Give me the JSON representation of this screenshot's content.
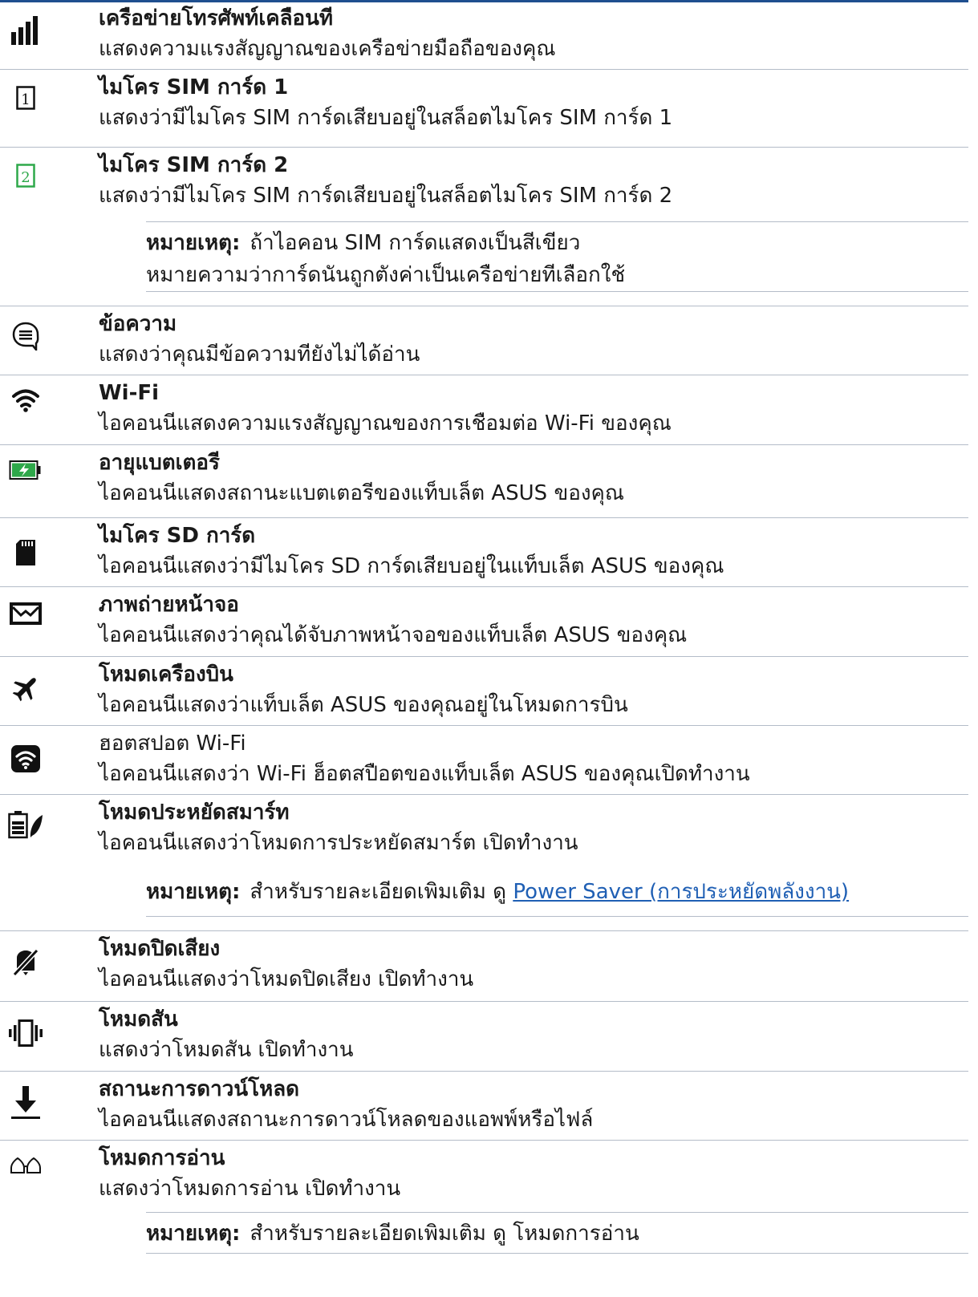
{
  "entries": [
    {
      "icon": "signal-bars-icon",
      "title": "เครือข่ายโทรศัพท์เคลือนที",
      "desc": "แสดงความแรงสัญญาณของเครือข่ายมือถือของคุณ"
    },
    {
      "icon": "sim-card-1-icon",
      "title": "ไมโคร SIM การ์ด 1",
      "desc": "แสดงว่ามีไมโคร SIM การ์ดเสียบอยู่ในสล็อตไมโคร SIM การ์ด 1"
    },
    {
      "icon": "sim-card-2-icon",
      "title": "ไมโคร SIM การ์ด 2",
      "desc": "แสดงว่ามีไมโคร SIM การ์ดเสียบอยู่ในสล็อตไมโคร SIM การ์ด 2"
    },
    {
      "icon": "message-icon",
      "title": "ข้อความ",
      "desc": "แสดงว่าคุณมีข้อความทียังไม่ได้อ่าน"
    },
    {
      "icon": "wifi-icon",
      "title": " Wi-Fi",
      "desc": "ไอคอนนีแสดงความแรงสัญญาณของการเชือมต่อ Wi-Fi ของคุณ"
    },
    {
      "icon": "battery-charging-icon",
      "title": "อายุแบตเตอรี",
      "desc": "ไอคอนนีแสดงสถานะแบตเตอรีของแท็บเล็ต ASUS ของคุณ"
    },
    {
      "icon": "sd-card-icon",
      "title": "ไมโคร SD การ์ด",
      "desc": "ไอคอนนีแสดงว่ามีไมโคร SD การ์ดเสียบอยู่ในแท็บเล็ต ASUS ของคุณ"
    },
    {
      "icon": "screenshot-icon",
      "title": "ภาพถ่ายหน้าจอ",
      "desc": "ไอคอนนีแสดงว่าคุณได้จับภาพหน้าจอของแท็บเล็ต ASUS ของคุณ"
    },
    {
      "icon": "airplane-icon",
      "title": "โหมดเครืองบิน",
      "desc": "ไอคอนนีแสดงว่าแท็บเล็ต ASUS ของคุณอยู่ในโหมดการบิน"
    },
    {
      "icon": "wifi-hotspot-icon",
      "title": "ฮอตสปอต Wi-Fi",
      "desc": "ไอคอนนีแสดงว่า Wi-Fi ฮ็อตสปือตของแท็บเล็ต ASUS ของคุณเปิดทำงาน"
    },
    {
      "icon": "smart-saving-icon",
      "title": "โหมดประหยัดสมาร์ท",
      "desc": "ไอคอนนีแสดงว่าโหมดการประหยัดสมาร์ต เปิดทำงาน"
    },
    {
      "icon": "mute-icon",
      "title": "โหมดปิดเสียง",
      "desc": "ไอคอนนีแสดงว่าโหมดปิดเสียง เปิดทำงาน"
    },
    {
      "icon": "vibrate-icon",
      "title": "โหมดสัน",
      "desc": "แสดงว่าโหมดสัน เปิดทำงาน"
    },
    {
      "icon": "download-icon",
      "title": "สถานะการดาวน์โหลด",
      "desc": "ไอคอนนีแสดงสถานะการดาวน์โหลดของแอพพ์หรือไฟล์"
    },
    {
      "icon": "reading-glasses-icon",
      "title": "โหมดการอ่าน",
      "desc": "แสดงว่าโหมดการอ่าน เปิดทำงาน"
    }
  ],
  "notes": {
    "note1": {
      "label": "หมายเหตุ:",
      "line1": "ถ้าไอคอน SIM การ์ดแสดงเป็นสีเขียว",
      "line2": "หมายความว่าการ์ดนันถูกตังค่าเป็นเครือข่ายทีเลือกใช้"
    },
    "note2": {
      "label": "หมายเหตุ:",
      "text": "สำหรับรายละเอียดเพิมเติม ดู",
      "link": "Power Saver (การประหยัดพลังงาน)"
    },
    "note3": {
      "label": "หมายเหตุ:",
      "text": "สำหรับรายละเอียดเพิมเติม ดู โหมดการอ่าน"
    }
  },
  "colors": {
    "rule": "#1f4f8f",
    "separator": "#b4bcc8",
    "sim2": "#2ea84a",
    "battery": "#2ea84a",
    "link": "#1f5fb4"
  }
}
